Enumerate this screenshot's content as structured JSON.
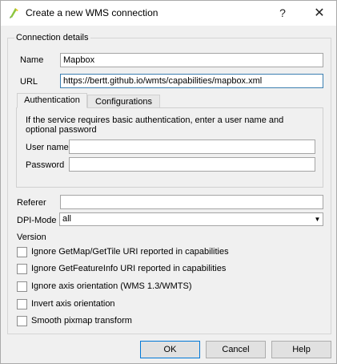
{
  "window": {
    "title": "Create a new WMS connection",
    "help_glyph": "?",
    "close_glyph": "✕",
    "icon": "qgis-icon"
  },
  "connection_details": {
    "group_title": "Connection details",
    "name_label": "Name",
    "name_value": "Mapbox",
    "url_label": "URL",
    "url_value": "https://bertt.github.io/wmts/capabilities/mapbox.xml"
  },
  "tabs": [
    {
      "label": "Authentication",
      "active": true
    },
    {
      "label": "Configurations",
      "active": false
    }
  ],
  "authentication": {
    "info_text": "If the service requires basic authentication, enter a user name and optional password",
    "username_label": "User name",
    "username_value": "",
    "password_label": "Password",
    "password_value": ""
  },
  "referer": {
    "label": "Referer",
    "value": ""
  },
  "dpi_mode": {
    "label": "DPI-Mode",
    "selected": "all",
    "arrow_glyph": "▼"
  },
  "version_label": "Version",
  "checkboxes": [
    {
      "label": "Ignore GetMap/GetTile URI reported in capabilities",
      "checked": false
    },
    {
      "label": "Ignore GetFeatureInfo URI reported in capabilities",
      "checked": false
    },
    {
      "label": "Ignore axis orientation (WMS 1.3/WMTS)",
      "checked": false
    },
    {
      "label": "Invert axis orientation",
      "checked": false
    },
    {
      "label": "Smooth pixmap transform",
      "checked": false
    }
  ],
  "buttons": {
    "ok": "OK",
    "cancel": "Cancel",
    "help": "Help"
  },
  "colors": {
    "focus_border": "#3c7fb1",
    "default_button_border": "#0078d7"
  }
}
